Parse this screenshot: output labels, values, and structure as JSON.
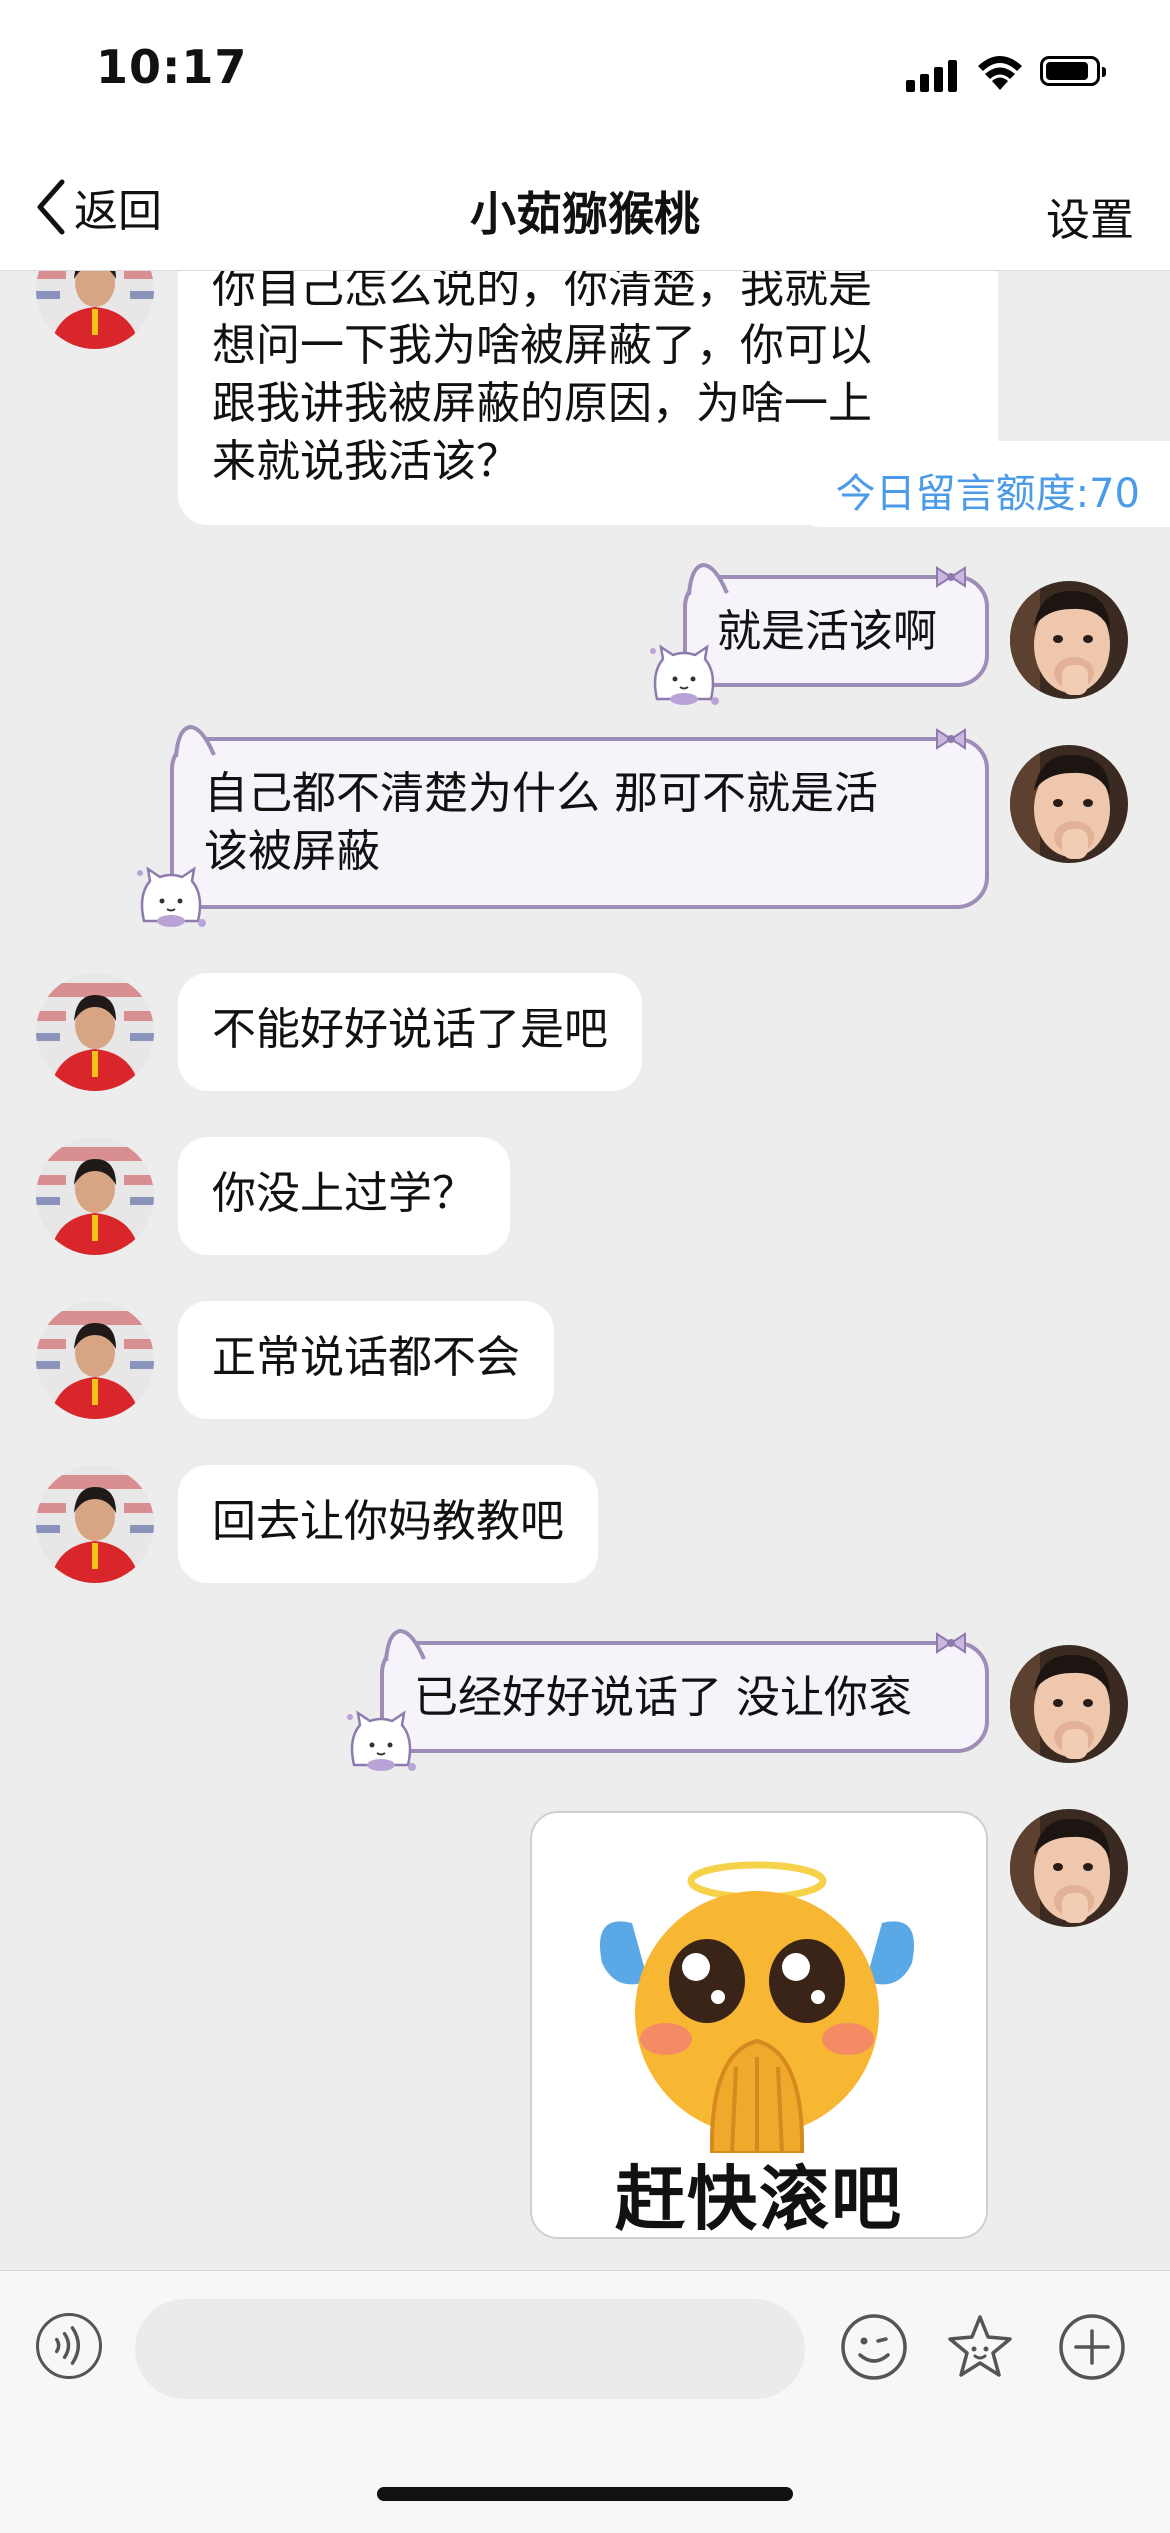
{
  "status_bar": {
    "time": "10:17"
  },
  "nav": {
    "back_label": "返回",
    "title": "小茹猕猴桃",
    "settings_label": "设置"
  },
  "quota_text": "今日留言额度:70",
  "messages": [
    {
      "side": "left",
      "lines": [
        "你自己怎么说的，你清楚，我就是",
        "想问一下我为啥被屏蔽了，你可以",
        "跟我讲我被屏蔽的原因，为啥一上",
        "来就说我活该？"
      ]
    },
    {
      "side": "right",
      "text": "就是活该啊"
    },
    {
      "side": "right",
      "lines": [
        "自己都不清楚为什么 那可不就是活",
        "该被屏蔽"
      ]
    },
    {
      "side": "left",
      "text": "不能好好说话了是吧"
    },
    {
      "side": "left",
      "text": "你没上过学？"
    },
    {
      "side": "left",
      "text": "正常说话都不会"
    },
    {
      "side": "left",
      "text": "回去让你妈教教吧"
    },
    {
      "side": "right",
      "text": "已经好好说话了 没让你衮"
    },
    {
      "side": "right",
      "type": "sticker",
      "caption": "赶快滚吧"
    }
  ],
  "input": {
    "placeholder": ""
  },
  "icons": {
    "back": "chevron-left-icon",
    "voice": "voice-icon",
    "emoji": "emoji-icon",
    "sticker": "sticker-star-icon",
    "plus": "plus-icon"
  },
  "colors": {
    "quota_text": "#4b9be8",
    "bubble_border": "#9d8db7",
    "bubble_fill": "#f6f3fb",
    "chat_bg": "#ededed"
  }
}
